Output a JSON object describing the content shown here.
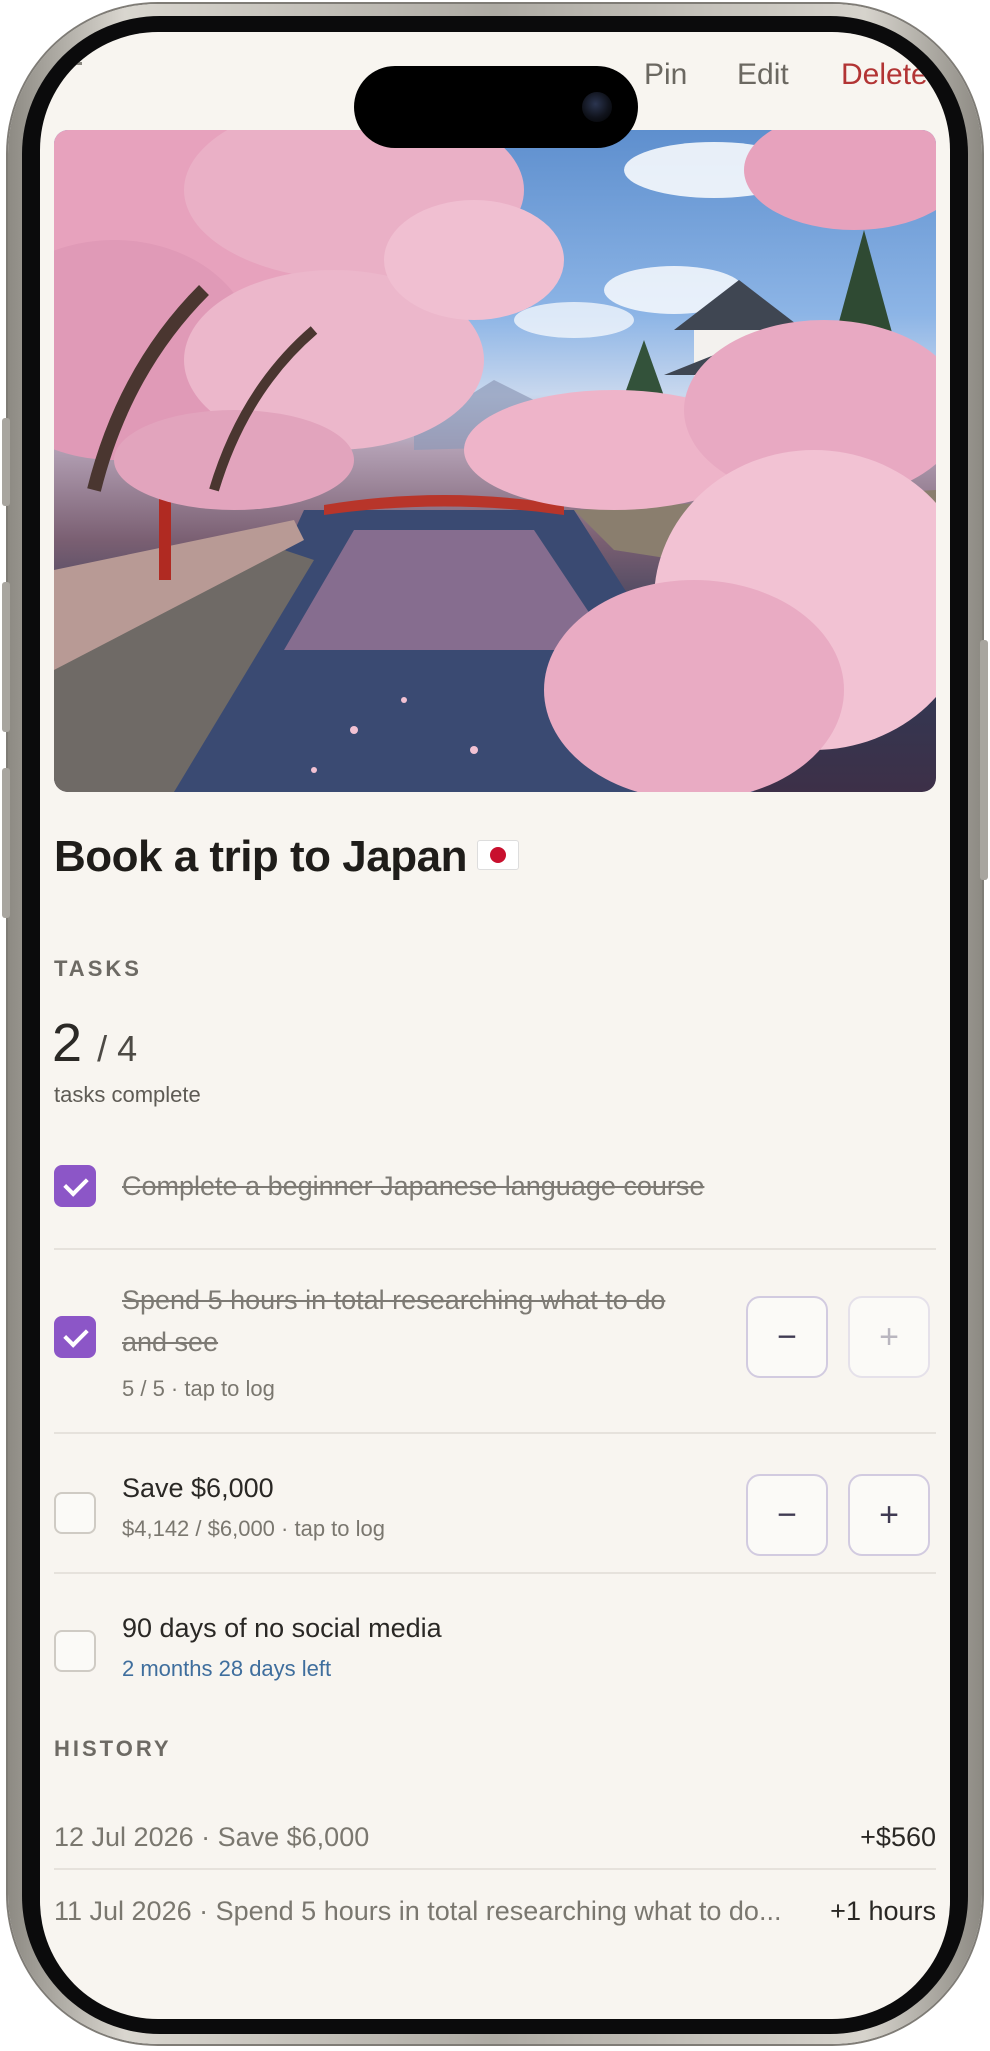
{
  "nav": {
    "pin_label": "Pin",
    "edit_label": "Edit",
    "delete_label": "Delete"
  },
  "goal": {
    "title": "Book a trip to Japan",
    "emoji_icon": "japan-flag"
  },
  "tasks_section": {
    "label": "TASKS",
    "completed": "2",
    "total": "/ 4",
    "caption": "tasks complete"
  },
  "tasks": [
    {
      "title": "Complete a beginner Japanese language course",
      "done": true
    },
    {
      "title_line1": "Spend 5 hours in total researching what to do",
      "title_line2": "and see",
      "sub": "5 / 5 · tap to log",
      "done": true,
      "minus_label": "−",
      "plus_label": "+"
    },
    {
      "title": "Save $6,000",
      "sub": "$4,142 / $6,000 · tap to log",
      "done": false,
      "minus_label": "−",
      "plus_label": "+"
    },
    {
      "title": "90 days of no social media",
      "sub": "2 months 28 days left",
      "done": false
    }
  ],
  "history_section": {
    "label": "HISTORY",
    "items": [
      {
        "text": "12 Jul 2026 · Save $6,000",
        "amount": "+$560"
      },
      {
        "text": "11 Jul 2026 · Spend 5 hours in total researching what to do...",
        "amount": "+1 hours"
      }
    ]
  },
  "colors": {
    "accent": "#8c56c7",
    "delete": "#b23434",
    "link": "#3f6e9d",
    "background": "#f8f5f0"
  }
}
